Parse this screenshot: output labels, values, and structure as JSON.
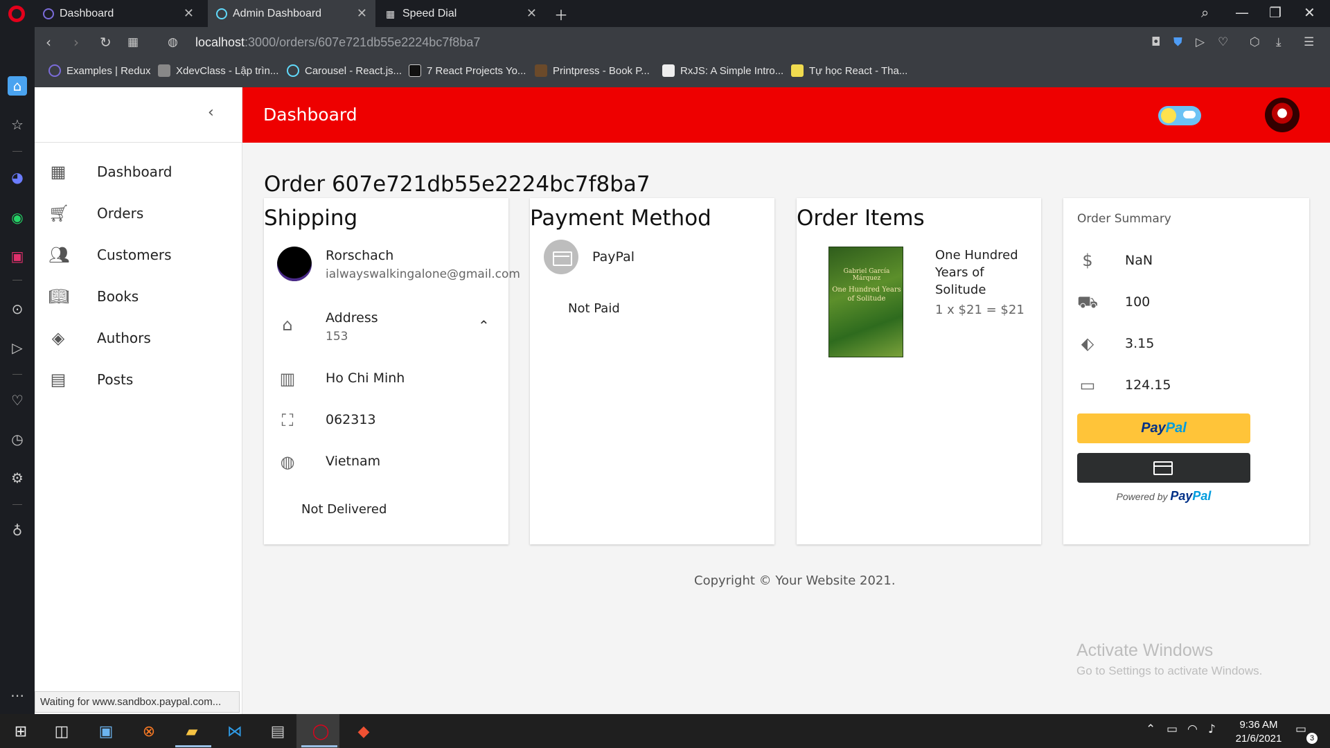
{
  "browser": {
    "tabs": [
      {
        "label": "Dashboard"
      },
      {
        "label": "Admin Dashboard"
      },
      {
        "label": "Speed Dial"
      }
    ],
    "url_host": "localhost",
    "url_path": ":3000/orders/607e721db55e2224bc7f8ba7",
    "bookmarks": [
      {
        "label": "Examples | Redux"
      },
      {
        "label": "XdevClass - Lập trìn..."
      },
      {
        "label": "Carousel - React.js..."
      },
      {
        "label": "7 React Projects Yo..."
      },
      {
        "label": "Printpress - Book P..."
      },
      {
        "label": "RxJS: A Simple Intro..."
      },
      {
        "label": "Tự học React - Tha..."
      }
    ],
    "status_text": "Waiting for www.sandbox.paypal.com..."
  },
  "sidebar": {
    "items": [
      {
        "label": "Dashboard",
        "icon": "dashboard-icon"
      },
      {
        "label": "Orders",
        "icon": "cart-icon"
      },
      {
        "label": "Customers",
        "icon": "people-icon"
      },
      {
        "label": "Books",
        "icon": "book-icon"
      },
      {
        "label": "Authors",
        "icon": "layers-icon"
      },
      {
        "label": "Posts",
        "icon": "post-add-icon"
      }
    ]
  },
  "header": {
    "title": "Dashboard",
    "accent_color": "#ee0000"
  },
  "order": {
    "title": "Order 607e721db55e2224bc7f8ba7",
    "shipping": {
      "title": "Shipping",
      "name": "Rorschach",
      "email": "ialwayswalkingalone@gmail.com",
      "address_label": "Address",
      "address_value": "153",
      "city": "Ho Chi Minh",
      "postal_code": "062313",
      "country": "Vietnam",
      "delivery_status": "Not Delivered"
    },
    "payment": {
      "title": "Payment Method",
      "method": "PayPal",
      "status": "Not Paid"
    },
    "items": {
      "title": "Order Items",
      "list": [
        {
          "name": "One Hundred Years of Solitude",
          "line": "1 x $21 = $21",
          "cover_author": "Gabriel García Márquez",
          "cover_title": "One Hundred Years of Solitude"
        }
      ]
    },
    "summary": {
      "title": "Order Summary",
      "rows": [
        {
          "icon": "dollar-icon",
          "value": "NaN"
        },
        {
          "icon": "truck-icon",
          "value": "100"
        },
        {
          "icon": "tag-icon",
          "value": "3.15"
        },
        {
          "icon": "credit-card-icon",
          "value": "124.15"
        }
      ],
      "paypal_pay": "Pay",
      "paypal_pal": "Pal",
      "powered_by": "Powered by",
      "powered_pay": "Pay",
      "powered_pal": "Pal"
    }
  },
  "footer": "Copyright © Your Website 2021.",
  "watermark": {
    "line1": "Activate Windows",
    "line2": "Go to Settings to activate Windows."
  },
  "taskbar": {
    "time": "9:36 AM",
    "date": "21/6/2021",
    "notifications": "3"
  }
}
